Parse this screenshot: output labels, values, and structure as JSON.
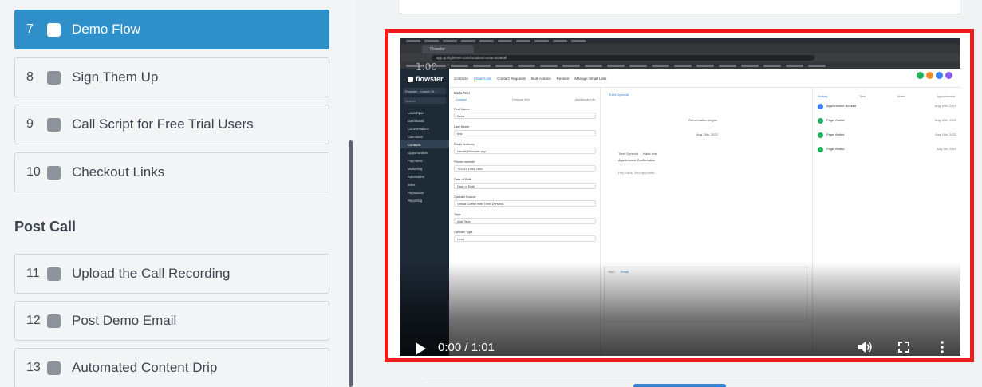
{
  "sidebar": {
    "steps_top": [
      {
        "number": "7",
        "label": "Demo Flow",
        "active": true
      },
      {
        "number": "8",
        "label": "Sign Them Up",
        "active": false
      },
      {
        "number": "9",
        "label": "Call Script for Free Trial Users",
        "active": false
      },
      {
        "number": "10",
        "label": "Checkout Links",
        "active": false
      }
    ],
    "section_title": "Post Call",
    "steps_bottom": [
      {
        "number": "11",
        "label": "Upload the Call Recording"
      },
      {
        "number": "12",
        "label": "Post Demo Email"
      },
      {
        "number": "13",
        "label": "Automated Content Drip"
      }
    ]
  },
  "video": {
    "current_time": "0:00",
    "duration": "1:01",
    "time_display": "0:00 / 1:01",
    "faint_time_label": "1:00",
    "buffered_fraction": 0.13,
    "screenshot": {
      "browser_tab": "Flowster",
      "url": "app.gohighlevel.com/location/contacts/detail",
      "app_logo": "flowster",
      "account": "Flowster - Cassie Gl...",
      "search_placeholder": "Search",
      "nav_items": [
        "Launchpad",
        "Dashboard",
        "Conversations",
        "Calendars",
        "Contacts",
        "Opportunities",
        "Payments",
        "Marketing",
        "Automation",
        "Sites",
        "Reputation",
        "Reporting"
      ],
      "active_nav": "Contacts",
      "top_tabs": [
        "Contacts",
        "Smart Lists",
        "Contact Requests",
        "Bulk Actions",
        "Restore",
        "Manage Smart Lists"
      ],
      "contact_name": "Karla Test",
      "form_tabs": [
        "Contact",
        "General Info",
        "Additional Info"
      ],
      "fields": [
        {
          "label": "First Name",
          "value": "Karla"
        },
        {
          "label": "Last Name",
          "value": "test"
        },
        {
          "label": "Email Address",
          "value": "karlatt@flowster.app"
        },
        {
          "label": "Phone number",
          "value": "+63 33 1998 2890"
        },
        {
          "label": "Date of Birth",
          "value": "Date of Birth"
        },
        {
          "label": "Contact Source",
          "value": "Virtual Coffee with Trent Dyrsmid"
        },
        {
          "label": "Tags",
          "value": "Add Tags"
        },
        {
          "label": "Contact Type",
          "value": "Lead"
        }
      ],
      "convo_texts": [
        "Trent Dyrsmid",
        "Conversation began",
        "Aug 11th, 2022",
        "Trent Dyrsmid → Karla test",
        "Appointment Confirmation",
        "Hey Karla, Your appointm..."
      ],
      "message_tabs": [
        "SMS",
        "Email"
      ],
      "activity_tabs": [
        "Activity",
        "Task",
        "Notes",
        "Appointment"
      ],
      "activity_items": [
        {
          "title": "Appointment Booked",
          "date": "Aug 15th, 2022"
        },
        {
          "title": "Page Visited",
          "date": "Aug 15th, 2022"
        },
        {
          "title": "Page Visited",
          "date": "Aug 11th, 2022"
        },
        {
          "title": "Page Visited",
          "date": "Aug 9th, 2022"
        }
      ]
    }
  },
  "icons": {
    "play": "play-icon",
    "volume": "volume-icon",
    "fullscreen": "fullscreen-icon",
    "more": "more-vertical-icon",
    "checkbox": "checkbox-icon"
  },
  "colors": {
    "active_step": "#2f8fc9",
    "highlight_border": "#ef1c1c",
    "sidebar_bg": "#f3f4f6",
    "text": "#3d4550"
  }
}
